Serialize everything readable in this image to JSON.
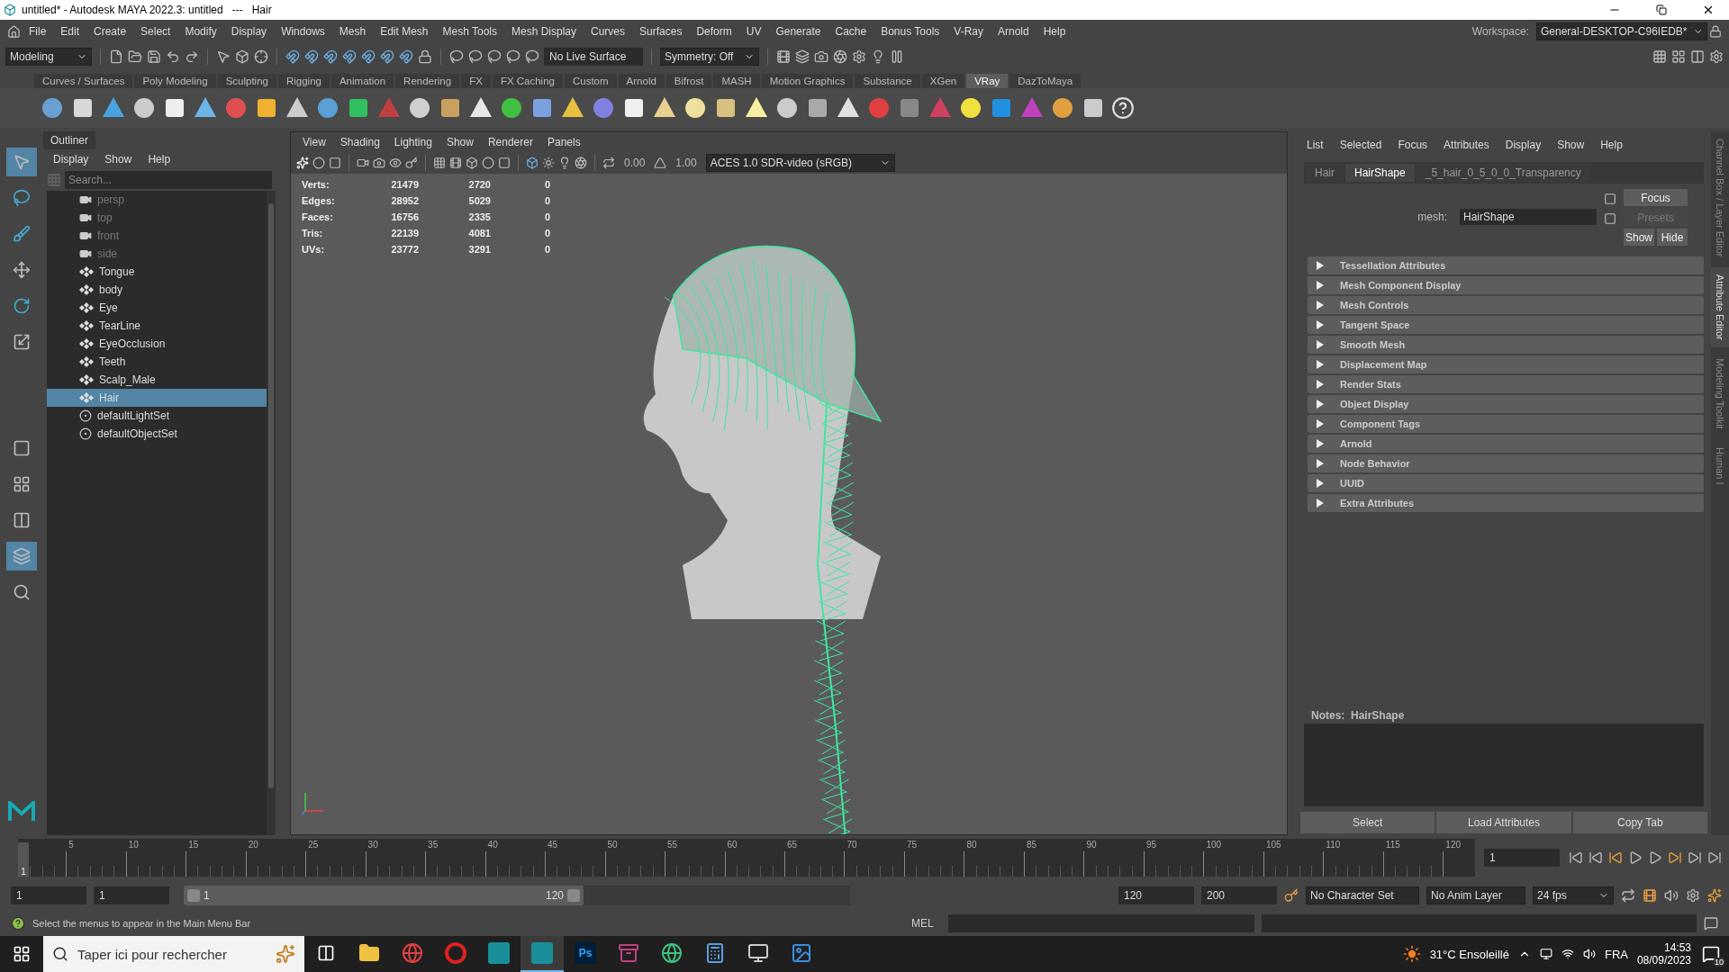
{
  "window": {
    "title": "untitled* - Autodesk MAYA 2022.3: untitled   ---   Hair"
  },
  "menu_bar": {
    "items": [
      "File",
      "Edit",
      "Create",
      "Select",
      "Modify",
      "Display",
      "Windows",
      "Mesh",
      "Edit Mesh",
      "Mesh Tools",
      "Mesh Display",
      "Curves",
      "Surfaces",
      "Deform",
      "UV",
      "Generate",
      "Cache",
      "Bonus Tools",
      "V-Ray",
      "Arnold",
      "Help"
    ],
    "workspace_label": "Workspace:",
    "workspace": "General-DESKTOP-C96IEDB*"
  },
  "status_line": {
    "mode": "Modeling",
    "live_surface": "No Live Surface",
    "symmetry": "Symmetry: Off"
  },
  "shelf_tabs": [
    {
      "label": "Curves / Surfaces",
      "selected": false
    },
    {
      "label": "Poly Modeling",
      "selected": false
    },
    {
      "label": "Sculpting",
      "selected": false
    },
    {
      "label": "Rigging",
      "selected": false
    },
    {
      "label": "Animation",
      "selected": false
    },
    {
      "label": "Rendering",
      "selected": false
    },
    {
      "label": "FX",
      "selected": false
    },
    {
      "label": "FX Caching",
      "selected": false
    },
    {
      "label": "Custom",
      "selected": false
    },
    {
      "label": "Arnold",
      "selected": false
    },
    {
      "label": "Bifrost",
      "selected": false
    },
    {
      "label": "MASH",
      "selected": false
    },
    {
      "label": "Motion Graphics",
      "selected": false
    },
    {
      "label": "Substance",
      "selected": false
    },
    {
      "label": "XGen",
      "selected": false
    },
    {
      "label": "VRay",
      "selected": true
    },
    {
      "label": "DazToMaya",
      "selected": false
    }
  ],
  "outliner": {
    "title": "Outliner",
    "menu": [
      "Display",
      "Show",
      "Help"
    ],
    "search_placeholder": "Search...",
    "items": [
      {
        "label": "persp",
        "kind": "camera",
        "dimmed": true,
        "selected": false
      },
      {
        "label": "top",
        "kind": "camera",
        "dimmed": true,
        "selected": false
      },
      {
        "label": "front",
        "kind": "camera",
        "dimmed": true,
        "selected": false
      },
      {
        "label": "side",
        "kind": "camera",
        "dimmed": true,
        "selected": false
      },
      {
        "label": "Tongue",
        "kind": "mesh",
        "dimmed": false,
        "selected": false
      },
      {
        "label": "body",
        "kind": "mesh",
        "dimmed": false,
        "selected": false
      },
      {
        "label": "Eye",
        "kind": "mesh",
        "dimmed": false,
        "selected": false
      },
      {
        "label": "TearLine",
        "kind": "mesh",
        "dimmed": false,
        "selected": false
      },
      {
        "label": "EyeOcclusion",
        "kind": "mesh",
        "dimmed": false,
        "selected": false
      },
      {
        "label": "Teeth",
        "kind": "mesh",
        "dimmed": false,
        "selected": false
      },
      {
        "label": "Scalp_Male",
        "kind": "mesh",
        "dimmed": false,
        "selected": false
      },
      {
        "label": "Hair",
        "kind": "mesh",
        "dimmed": false,
        "selected": true
      },
      {
        "label": "defaultLightSet",
        "kind": "set",
        "dimmed": false,
        "selected": false
      },
      {
        "label": "defaultObjectSet",
        "kind": "set",
        "dimmed": false,
        "selected": false
      }
    ]
  },
  "viewport": {
    "menu": [
      "View",
      "Shading",
      "Lighting",
      "Show",
      "Renderer",
      "Panels"
    ],
    "exposure": "0.00",
    "gamma": "1.00",
    "color_space": "ACES 1.0 SDR-video (sRGB)",
    "hud": [
      {
        "label": "Verts:",
        "values": [
          "21479",
          "2720",
          "0"
        ]
      },
      {
        "label": "Edges:",
        "values": [
          "28952",
          "5029",
          "0"
        ]
      },
      {
        "label": "Faces:",
        "values": [
          "16756",
          "2335",
          "0"
        ]
      },
      {
        "label": "Tris:",
        "values": [
          "22139",
          "4081",
          "0"
        ]
      },
      {
        "label": "UVs:",
        "values": [
          "23772",
          "3291",
          "0"
        ]
      }
    ]
  },
  "attribute_editor": {
    "menu": [
      "List",
      "Selected",
      "Focus",
      "Attributes",
      "Display",
      "Show",
      "Help"
    ],
    "tabs": [
      {
        "label": "Hair",
        "selected": false
      },
      {
        "label": "HairShape",
        "selected": true
      },
      {
        "label": "_5_hair_0_5_0_0_Transparency",
        "selected": false
      }
    ],
    "node_label": "mesh:",
    "node_name": "HairShape",
    "side_buttons": [
      {
        "label": "Focus",
        "disabled": false
      },
      {
        "label": "Presets",
        "disabled": true
      },
      {
        "label": "Show",
        "disabled": false
      },
      {
        "label": "Hide",
        "disabled": false
      }
    ],
    "sections": [
      {
        "label": "Tessellation Attributes",
        "expanded": false
      },
      {
        "label": "Mesh Component Display",
        "expanded": false
      },
      {
        "label": "Mesh Controls",
        "expanded": false
      },
      {
        "label": "Tangent Space",
        "expanded": false
      },
      {
        "label": "Smooth Mesh",
        "expanded": false
      },
      {
        "label": "Displacement Map",
        "expanded": false
      },
      {
        "label": "Render Stats",
        "expanded": false
      },
      {
        "label": "Object Display",
        "expanded": false
      },
      {
        "label": "Component Tags",
        "expanded": false
      },
      {
        "label": "Arnold",
        "expanded": false
      },
      {
        "label": "Node Behavior",
        "expanded": false
      },
      {
        "label": "UUID",
        "expanded": false
      },
      {
        "label": "Extra Attributes",
        "expanded": false
      }
    ],
    "notes_label": "Notes:  HairShape",
    "bottom_buttons": [
      "Select",
      "Load Attributes",
      "Copy Tab"
    ]
  },
  "side_tabs": [
    {
      "label": "Channel Box / Layer Editor",
      "selected": false
    },
    {
      "label": "Attribute Editor",
      "selected": true
    },
    {
      "label": "Modeling Toolkit",
      "selected": false
    },
    {
      "label": "Human I",
      "selected": false
    }
  ],
  "timeline": {
    "tick_labels": [
      "5",
      "10",
      "15",
      "20",
      "25",
      "30",
      "35",
      "40",
      "45",
      "50",
      "55",
      "60",
      "65",
      "70",
      "75",
      "80",
      "85",
      "90",
      "95",
      "100",
      "105",
      "110",
      "115",
      "120"
    ],
    "current_frame": "1",
    "level": 0,
    "frame_field": "1"
  },
  "range": {
    "level": 0.6,
    "start": "1",
    "playback_start": "1",
    "slider_start": "1",
    "slider_end": "120",
    "playback_end": "120",
    "end": "200",
    "character_set": "No Character Set",
    "anim_layer": "No Anim Layer",
    "fps": "24 fps"
  },
  "command_line": {
    "help": "Select the menus to appear in the Main Menu Bar",
    "language": "MEL"
  },
  "taskbar": {
    "search_placeholder": "Taper ici pour rechercher",
    "apps": [
      {
        "kind": "explorer",
        "active": false
      },
      {
        "kind": "chrome",
        "active": false
      },
      {
        "kind": "opera",
        "active": false
      },
      {
        "kind": "maya",
        "active": false
      },
      {
        "kind": "maya",
        "active": true
      },
      {
        "kind": "photoshop",
        "label": "Ps",
        "active": false
      },
      {
        "kind": "archive",
        "active": false
      },
      {
        "kind": "globe",
        "active": false
      },
      {
        "kind": "calculator",
        "active": false
      },
      {
        "kind": "window",
        "active": false
      },
      {
        "kind": "image",
        "active": false
      }
    ],
    "weather": "31°C  Ensoleillé",
    "language": "FRA",
    "time": "14:53",
    "date": "08/09/2023",
    "notifications": "10"
  }
}
